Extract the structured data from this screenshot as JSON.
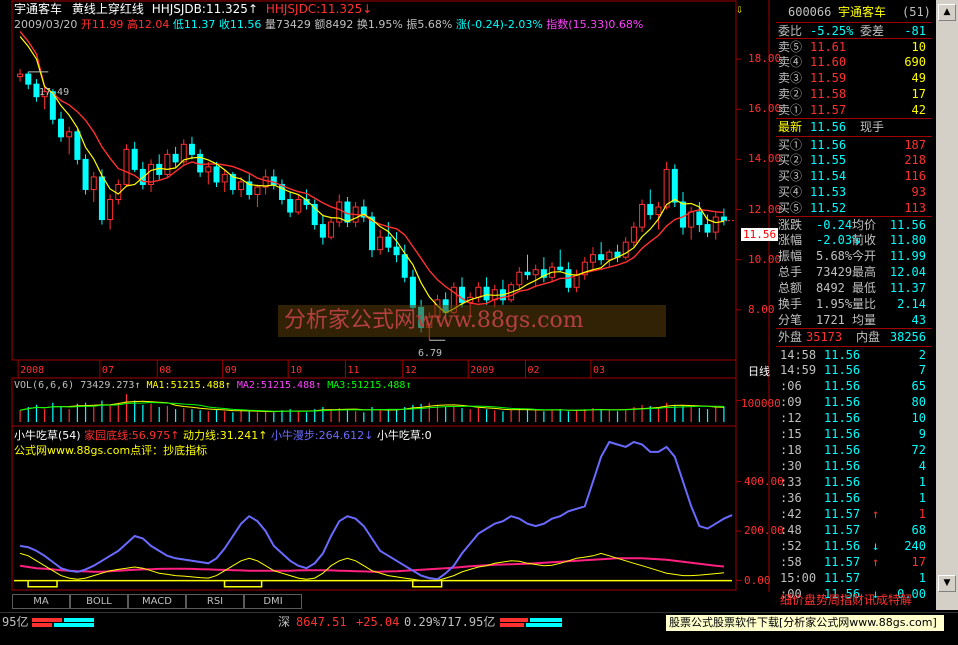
{
  "header": {
    "stock_name": "宇通客车",
    "formula_name": "黄线上穿红线",
    "line1_label": "HHJSJDB:11.325",
    "line1_arrow": "↑",
    "line2_label": "HHJSJDC:11.325",
    "line2_arrow": "↓",
    "date": "2009/03/20",
    "open_label": "开11.99",
    "high_label": "高12.04",
    "low_label": "低11.37",
    "close_label": "收11.56",
    "volume_label": "量73429",
    "amount_label": "额8492",
    "turnover_label": "换1.95%",
    "amplitude_label": "振5.68%",
    "change_label": "涨(-0.24)-2.03%",
    "index_label": "指数(15.33)0.68%"
  },
  "price_axis": [
    "18.00",
    "16.00",
    "14.00",
    "12.00",
    "10.00",
    "8.00"
  ],
  "price_marker": "11.56",
  "high_annotation": "17.49",
  "low_annotation": "6.79",
  "time_axis": [
    "2008",
    "07",
    "08",
    "09",
    "10",
    "11",
    "12",
    "2009",
    "02",
    "03"
  ],
  "period_label": "日线",
  "volume_panel": {
    "label": "VOL(6,6,6)",
    "vol_value": "73429.273",
    "ma1": "MA1:51215.488",
    "ma2": "MA2:51215.488",
    "ma3": "MA3:51215.488",
    "arrow_up": "↑",
    "axis_label": "100000"
  },
  "indicator_panel": {
    "name": "小牛吃草(54)",
    "jiayuan": "家园底线:56.975",
    "dongli": "动力线:31.241",
    "manbu": "小牛漫步:264.612",
    "chicao": "小牛吃草:0",
    "arrow_up": "↑",
    "arrow_down": "↓",
    "comment": "公式网www.88gs.com点评：抄底指标",
    "axis": [
      "400.00",
      "200.00",
      "0.00"
    ]
  },
  "watermark": "分析家公式网www.88gs.com",
  "tabs": [
    "MA",
    "BOLL",
    "MACD",
    "RSI",
    "DMI"
  ],
  "panel": {
    "code": "600066",
    "name": "宇通客车",
    "num": "(51)",
    "webi_label": "委比",
    "webi_value": "-5.25%",
    "weicha_label": "委差",
    "weicha_value": "-81",
    "asks": [
      {
        "label": "卖⑤",
        "price": "11.61",
        "vol": "10"
      },
      {
        "label": "卖④",
        "price": "11.60",
        "vol": "690"
      },
      {
        "label": "卖③",
        "price": "11.59",
        "vol": "49"
      },
      {
        "label": "卖②",
        "price": "11.58",
        "vol": "17"
      },
      {
        "label": "卖①",
        "price": "11.57",
        "vol": "42"
      }
    ],
    "latest_label": "最新",
    "latest_value": "11.56",
    "now_hand": "现手",
    "bids": [
      {
        "label": "买①",
        "price": "11.56",
        "vol": "187"
      },
      {
        "label": "买②",
        "price": "11.55",
        "vol": "218"
      },
      {
        "label": "买③",
        "price": "11.54",
        "vol": "116"
      },
      {
        "label": "买④",
        "price": "11.53",
        "vol": "93"
      },
      {
        "label": "买⑤",
        "price": "11.52",
        "vol": "113"
      }
    ],
    "stats": [
      {
        "l1": "涨跌",
        "v1": "-0.24",
        "l2": "均价",
        "v2": "11.56"
      },
      {
        "l1": "涨幅",
        "v1": "-2.03%",
        "l2": "前收",
        "v2": "11.80"
      },
      {
        "l1": "振幅",
        "v1": "5.68%",
        "l2": "今开",
        "v2": "11.99"
      },
      {
        "l1": "总手",
        "v1": "73429",
        "l2": "最高",
        "v2": "12.04"
      },
      {
        "l1": "总额",
        "v1": "8492",
        "l2": "最低",
        "v2": "11.37"
      },
      {
        "l1": "换手",
        "v1": "1.95%",
        "l2": "量比",
        "v2": "2.14"
      },
      {
        "l1": "分笔",
        "v1": "1721",
        "l2": "均量",
        "v2": "43"
      }
    ],
    "outer_label": "外盘",
    "outer_value": "35173",
    "inner_label": "内盘",
    "inner_value": "38256",
    "ticks": [
      {
        "t": "14:58",
        "p": "11.56",
        "a": "",
        "v": "2"
      },
      {
        "t": "14:59",
        "p": "11.56",
        "a": "",
        "v": "7"
      },
      {
        "t": ":06",
        "p": "11.56",
        "a": "",
        "v": "65"
      },
      {
        "t": ":09",
        "p": "11.56",
        "a": "",
        "v": "80"
      },
      {
        "t": ":12",
        "p": "11.56",
        "a": "",
        "v": "10"
      },
      {
        "t": ":15",
        "p": "11.56",
        "a": "",
        "v": "9"
      },
      {
        "t": ":18",
        "p": "11.56",
        "a": "",
        "v": "72"
      },
      {
        "t": ":30",
        "p": "11.56",
        "a": "",
        "v": "4"
      },
      {
        "t": ":33",
        "p": "11.56",
        "a": "",
        "v": "1"
      },
      {
        "t": ":36",
        "p": "11.56",
        "a": "",
        "v": "1"
      },
      {
        "t": ":42",
        "p": "11.57",
        "a": "↑",
        "v": "1"
      },
      {
        "t": ":48",
        "p": "11.57",
        "a": "",
        "v": "68"
      },
      {
        "t": ":52",
        "p": "11.56",
        "a": "↓",
        "v": "240"
      },
      {
        "t": ":58",
        "p": "11.57",
        "a": "↑",
        "v": "17"
      },
      {
        "t": "15:00",
        "p": "11.57",
        "a": "",
        "v": "1"
      },
      {
        "t": ":00",
        "p": "11.56",
        "a": "↓",
        "v": "0.00"
      }
    ],
    "footer": "细价盘势周指财讯成特解"
  },
  "statusbar": {
    "left_amount": "95亿",
    "sz_label": "深",
    "sz_index": "8647.51",
    "sz_change": "+25.04",
    "sz_pct": "0.29%",
    "sz_amount": "717.95亿",
    "ad_text": "股票公式股票软件下载[分析家公式网www.88gs.com]"
  },
  "colors": {
    "up": "#ff3030",
    "down": "#00ffff",
    "yellow": "#ffff00",
    "white": "#ffffff",
    "grid_red": "#a00000",
    "magenta": "#ff40ff",
    "green": "#00ff00",
    "blue_line": "#6a6aff"
  },
  "chart_data": {
    "type": "line",
    "price_axis_range": [
      6,
      19
    ],
    "indicator_axis_range": [
      -30,
      560
    ],
    "candles": [
      [
        17.3,
        17.6,
        17.1,
        17.4
      ],
      [
        17.4,
        17.5,
        16.8,
        17.0
      ],
      [
        17.0,
        17.2,
        16.3,
        16.5
      ],
      [
        16.5,
        16.9,
        16.0,
        16.7
      ],
      [
        16.7,
        16.8,
        15.4,
        15.6
      ],
      [
        15.6,
        15.9,
        14.7,
        14.9
      ],
      [
        14.9,
        15.3,
        14.2,
        15.1
      ],
      [
        15.1,
        15.2,
        13.8,
        14.0
      ],
      [
        14.0,
        14.2,
        12.6,
        12.8
      ],
      [
        12.8,
        13.5,
        12.3,
        13.3
      ],
      [
        13.3,
        13.6,
        11.4,
        11.6
      ],
      [
        11.6,
        12.6,
        11.2,
        12.4
      ],
      [
        12.4,
        13.2,
        12.2,
        13.0
      ],
      [
        13.0,
        14.6,
        12.9,
        14.4
      ],
      [
        14.4,
        14.7,
        13.5,
        13.6
      ],
      [
        13.6,
        13.9,
        12.8,
        13.0
      ],
      [
        13.0,
        14.0,
        12.7,
        13.8
      ],
      [
        13.8,
        14.2,
        13.2,
        13.4
      ],
      [
        13.4,
        14.4,
        13.3,
        14.2
      ],
      [
        14.2,
        14.5,
        13.7,
        13.9
      ],
      [
        13.9,
        14.8,
        13.8,
        14.6
      ],
      [
        14.6,
        14.9,
        14.0,
        14.2
      ],
      [
        14.2,
        14.4,
        13.3,
        13.5
      ],
      [
        13.5,
        13.9,
        13.0,
        13.7
      ],
      [
        13.7,
        13.9,
        12.9,
        13.1
      ],
      [
        13.1,
        13.6,
        12.7,
        13.4
      ],
      [
        13.4,
        13.5,
        12.6,
        12.8
      ],
      [
        12.8,
        13.3,
        12.5,
        13.1
      ],
      [
        13.1,
        13.4,
        12.4,
        12.6
      ],
      [
        12.6,
        13.0,
        12.1,
        12.9
      ],
      [
        12.9,
        13.6,
        12.6,
        13.3
      ],
      [
        13.3,
        13.6,
        12.8,
        13.0
      ],
      [
        13.0,
        13.2,
        12.2,
        12.4
      ],
      [
        12.4,
        12.7,
        11.7,
        11.9
      ],
      [
        11.9,
        12.6,
        11.8,
        12.4
      ],
      [
        12.4,
        12.8,
        12.0,
        12.2
      ],
      [
        12.2,
        12.4,
        11.2,
        11.4
      ],
      [
        11.4,
        11.8,
        10.6,
        10.9
      ],
      [
        10.9,
        11.7,
        10.8,
        11.5
      ],
      [
        11.5,
        12.6,
        11.3,
        12.3
      ],
      [
        12.3,
        12.5,
        11.3,
        11.5
      ],
      [
        11.5,
        12.3,
        11.3,
        12.1
      ],
      [
        12.1,
        12.4,
        11.5,
        11.7
      ],
      [
        11.7,
        11.9,
        10.1,
        10.4
      ],
      [
        10.4,
        11.2,
        10.2,
        10.9
      ],
      [
        10.9,
        11.5,
        10.3,
        10.5
      ],
      [
        10.5,
        11.1,
        9.9,
        10.2
      ],
      [
        10.2,
        10.6,
        9.1,
        9.3
      ],
      [
        9.3,
        9.6,
        7.9,
        8.1
      ],
      [
        8.1,
        8.4,
        7.1,
        7.3
      ],
      [
        7.3,
        7.9,
        6.8,
        7.7
      ],
      [
        7.7,
        8.6,
        7.5,
        8.4
      ],
      [
        8.4,
        8.7,
        7.7,
        7.9
      ],
      [
        7.9,
        9.1,
        7.8,
        8.9
      ],
      [
        8.9,
        9.3,
        8.1,
        8.3
      ],
      [
        8.3,
        8.7,
        7.7,
        8.5
      ],
      [
        8.5,
        9.1,
        8.3,
        8.9
      ],
      [
        8.9,
        9.3,
        8.2,
        8.4
      ],
      [
        8.4,
        9.0,
        8.1,
        8.8
      ],
      [
        8.8,
        9.2,
        8.2,
        8.4
      ],
      [
        8.4,
        9.1,
        8.3,
        9.0
      ],
      [
        9.0,
        9.7,
        8.8,
        9.5
      ],
      [
        9.5,
        10.2,
        9.2,
        9.4
      ],
      [
        9.4,
        9.8,
        8.9,
        9.6
      ],
      [
        9.6,
        10.1,
        9.1,
        9.3
      ],
      [
        9.3,
        9.9,
        9.1,
        9.7
      ],
      [
        9.7,
        10.4,
        9.5,
        9.6
      ],
      [
        9.6,
        9.9,
        8.7,
        8.9
      ],
      [
        8.9,
        9.6,
        8.7,
        9.4
      ],
      [
        9.4,
        10.1,
        9.2,
        9.9
      ],
      [
        9.9,
        10.5,
        9.6,
        10.2
      ],
      [
        10.2,
        10.7,
        9.8,
        10.0
      ],
      [
        10.0,
        10.4,
        9.7,
        10.3
      ],
      [
        10.3,
        10.6,
        9.9,
        10.1
      ],
      [
        10.1,
        10.9,
        10.0,
        10.7
      ],
      [
        10.7,
        11.5,
        10.5,
        11.3
      ],
      [
        11.3,
        12.4,
        11.1,
        12.2
      ],
      [
        12.2,
        12.8,
        11.6,
        11.8
      ],
      [
        11.8,
        12.3,
        11.2,
        12.1
      ],
      [
        12.1,
        13.9,
        12.0,
        13.6
      ],
      [
        13.6,
        13.8,
        12.1,
        12.3
      ],
      [
        12.3,
        12.7,
        11.0,
        11.3
      ],
      [
        11.3,
        12.1,
        10.8,
        11.9
      ],
      [
        11.9,
        12.3,
        11.1,
        11.4
      ],
      [
        11.4,
        11.8,
        10.9,
        11.1
      ],
      [
        11.1,
        11.9,
        10.8,
        11.7
      ],
      [
        11.7,
        12.04,
        11.37,
        11.56
      ]
    ],
    "volume": [
      0.55,
      0.7,
      0.8,
      0.6,
      0.9,
      0.75,
      0.6,
      0.85,
      0.9,
      0.7,
      1.0,
      0.8,
      0.9,
      1.3,
      1.0,
      0.8,
      0.85,
      0.7,
      0.75,
      0.6,
      0.65,
      0.6,
      0.55,
      0.5,
      0.6,
      0.5,
      0.45,
      0.55,
      0.5,
      0.45,
      0.5,
      0.45,
      0.55,
      0.6,
      0.5,
      0.45,
      0.6,
      0.7,
      0.6,
      0.65,
      0.55,
      0.5,
      0.45,
      0.7,
      0.6,
      0.55,
      0.6,
      0.7,
      0.8,
      0.85,
      0.9,
      0.8,
      0.7,
      0.75,
      0.65,
      0.6,
      0.65,
      0.6,
      0.55,
      0.5,
      0.55,
      0.65,
      0.6,
      0.55,
      0.5,
      0.55,
      0.6,
      0.5,
      0.55,
      0.6,
      0.65,
      0.6,
      0.55,
      0.5,
      0.6,
      0.7,
      0.8,
      0.75,
      0.7,
      0.9,
      0.8,
      0.75,
      0.7,
      0.65,
      0.6,
      0.7,
      0.73
    ],
    "manbu": [
      140,
      135,
      120,
      100,
      75,
      50,
      40,
      35,
      45,
      60,
      80,
      100,
      120,
      150,
      180,
      170,
      140,
      120,
      100,
      90,
      85,
      80,
      75,
      70,
      90,
      130,
      180,
      230,
      260,
      240,
      200,
      140,
      110,
      80,
      60,
      50,
      70,
      110,
      180,
      240,
      260,
      250,
      220,
      170,
      120,
      100,
      80,
      60,
      40,
      20,
      10,
      5,
      30,
      60,
      110,
      150,
      190,
      210,
      230,
      240,
      260,
      250,
      230,
      220,
      230,
      250,
      260,
      280,
      290,
      300,
      400,
      500,
      560,
      550,
      540,
      560,
      550,
      520,
      520,
      540,
      500,
      400,
      300,
      220,
      210,
      230,
      250,
      264.6
    ],
    "jiayuan": [
      60,
      55,
      50,
      48,
      45,
      42,
      40,
      38,
      37,
      36,
      36,
      38,
      40,
      42,
      44,
      45,
      46,
      47,
      48,
      48,
      48,
      47,
      46,
      45,
      44,
      43,
      42,
      41,
      40,
      40,
      40,
      40,
      40,
      40,
      41,
      42,
      42,
      42,
      41,
      40,
      39,
      38,
      37,
      36,
      36,
      37,
      38,
      40,
      42,
      44,
      46,
      48,
      50,
      52,
      55,
      58,
      60,
      62,
      64,
      65,
      66,
      67,
      68,
      70,
      72,
      74,
      76,
      78,
      80,
      82,
      84,
      86,
      88,
      90,
      90,
      90,
      90,
      88,
      86,
      84,
      80,
      76,
      72,
      68,
      64,
      60,
      56.975
    ],
    "dongli": [
      110,
      100,
      80,
      60,
      40,
      20,
      10,
      5,
      10,
      20,
      30,
      40,
      45,
      50,
      55,
      50,
      40,
      30,
      25,
      20,
      18,
      15,
      12,
      10,
      20,
      40,
      60,
      80,
      90,
      80,
      60,
      40,
      30,
      20,
      10,
      5,
      10,
      30,
      60,
      80,
      90,
      80,
      60,
      40,
      30,
      20,
      15,
      10,
      5,
      0,
      0,
      0,
      10,
      20,
      35,
      45,
      55,
      60,
      70,
      75,
      80,
      78,
      70,
      65,
      60,
      62,
      70,
      80,
      90,
      95,
      100,
      110,
      100,
      90,
      80,
      70,
      60,
      50,
      40,
      30,
      25,
      20,
      20,
      22,
      25,
      28,
      31.241
    ],
    "chicao_lows": [
      [
        0,
        5
      ],
      [
        24,
        30
      ],
      [
        47,
        52
      ]
    ]
  }
}
